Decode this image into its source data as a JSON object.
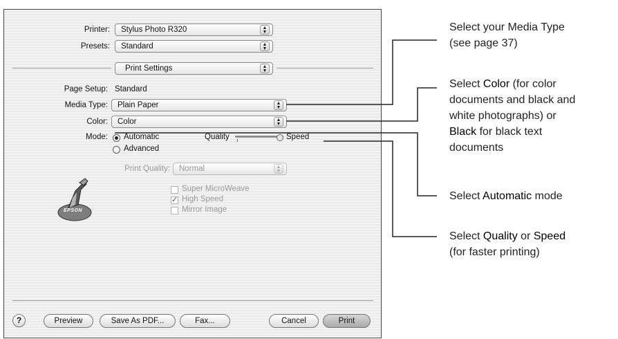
{
  "dialog": {
    "printer_label": "Printer:",
    "printer_value": "Stylus Photo R320",
    "presets_label": "Presets:",
    "presets_value": "Standard",
    "panel_value": "Print Settings",
    "page_setup_label": "Page Setup:",
    "page_setup_value": "Standard",
    "media_type_label": "Media Type:",
    "media_type_value": "Plain Paper",
    "color_label": "Color:",
    "color_value": "Color",
    "mode_label": "Mode:",
    "mode_automatic": "Automatic",
    "mode_advanced": "Advanced",
    "slider_quality": "Quality",
    "slider_speed": "Speed",
    "slider_level": 1.0,
    "print_quality_label": "Print Quality:",
    "print_quality_value": "Normal",
    "check_super_microweave": "Super MicroWeave",
    "check_high_speed": "High Speed",
    "check_mirror_image": "Mirror Image",
    "logo_text": "EPSON",
    "buttons": {
      "help": "?",
      "preview": "Preview",
      "save_pdf": "Save As PDF...",
      "fax": "Fax...",
      "cancel": "Cancel",
      "print": "Print"
    }
  },
  "callouts": {
    "media": {
      "line1": "Select your Media Type",
      "line2": "(see page 37)"
    },
    "color": {
      "pre": "Select ",
      "color_word": "Color",
      "post1": " (for color",
      "line2": "documents and black and",
      "line3": "white photographs) or",
      "black_word": "Black",
      "post4": " for black text",
      "line5": "documents"
    },
    "mode": {
      "pre": "Select ",
      "auto_word": "Automatic",
      "post": " mode"
    },
    "quality": {
      "pre": "Select ",
      "quality_word": "Quality",
      "mid": " or ",
      "speed_word": "Speed",
      "line2": "(for faster printing)"
    }
  }
}
